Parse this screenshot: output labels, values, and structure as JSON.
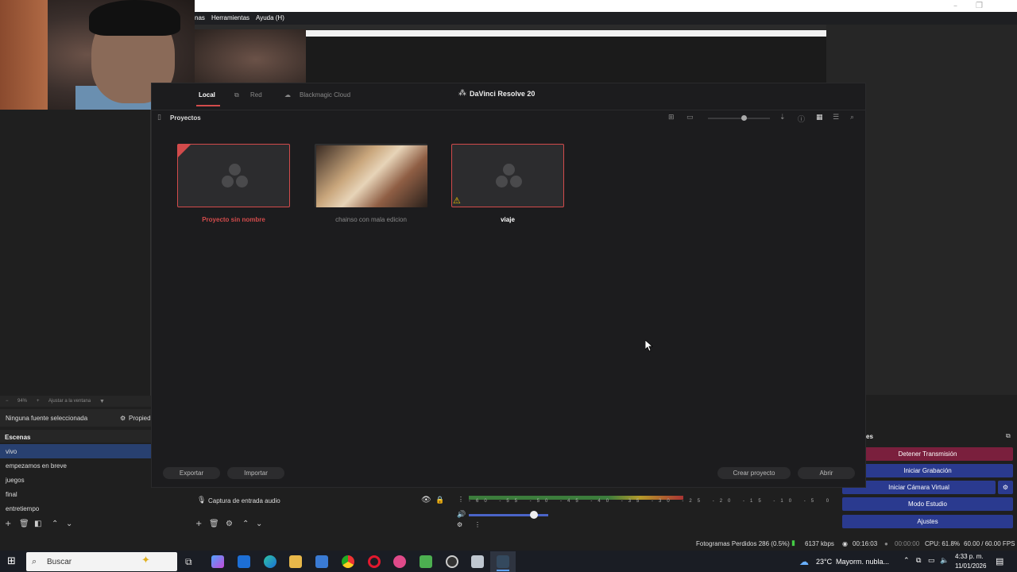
{
  "obs_menu": [
    "nas",
    "Herramientas",
    "Ayuda (H)"
  ],
  "window_controls": [
    "–",
    "❐"
  ],
  "zoom_bar": {
    "zoom": "94%",
    "fit": "Ajustar a la ventana"
  },
  "sources_bar": {
    "no_source": "Ninguna fuente seleccionada",
    "properties": "Propied"
  },
  "scenes": {
    "header": "Escenas",
    "items": [
      "vivo",
      "empezamos en breve",
      "juegos",
      "final",
      "entretiempo"
    ]
  },
  "audio": {
    "label": "Captura de entrada audio"
  },
  "mixer": {
    "ticks": "-60 -55 -50 -45 -40 -35 -30 -25 -20 -15 -10 -5 0"
  },
  "controls": {
    "header": "es",
    "buttons": [
      "Detener Transmisión",
      "Iniciar Grabación",
      "Iniciar Cámara Virtual",
      "Modo Estudio",
      "Ajustes"
    ]
  },
  "status": {
    "dropped": "Fotogramas Perdidos 286 (0.5%)",
    "kbps": "6137 kbps",
    "live_time": "00:16:03",
    "rec_time": "00:00:00",
    "cpu": "CPU: 61.8%",
    "fps": "60.00 / 60.00 FPS"
  },
  "davinci": {
    "tabs": [
      "Local",
      "Red",
      "Blackmagic Cloud"
    ],
    "title": "DaVinci Resolve 20",
    "section": "Proyectos",
    "projects": [
      {
        "name": "Proyecto sin nombre",
        "state": "selected"
      },
      {
        "name": "chainso con mala edicion",
        "state": "thumbnail"
      },
      {
        "name": "viaje",
        "state": "warning"
      }
    ],
    "buttons": {
      "export": "Exportar",
      "import": "Importar",
      "create": "Crear proyecto",
      "open": "Abrir"
    }
  },
  "taskbar": {
    "search_placeholder": "Buscar",
    "weather": "23°C",
    "weather_desc": "Mayorm. nubla...",
    "time": "4:33 p. m.",
    "date": "11/01/2026"
  },
  "colors": {
    "accent_red": "#d24b4b",
    "obs_blue": "#2a3a8f",
    "stop_red": "#7a1f3d",
    "selected_scene": "#284070"
  }
}
